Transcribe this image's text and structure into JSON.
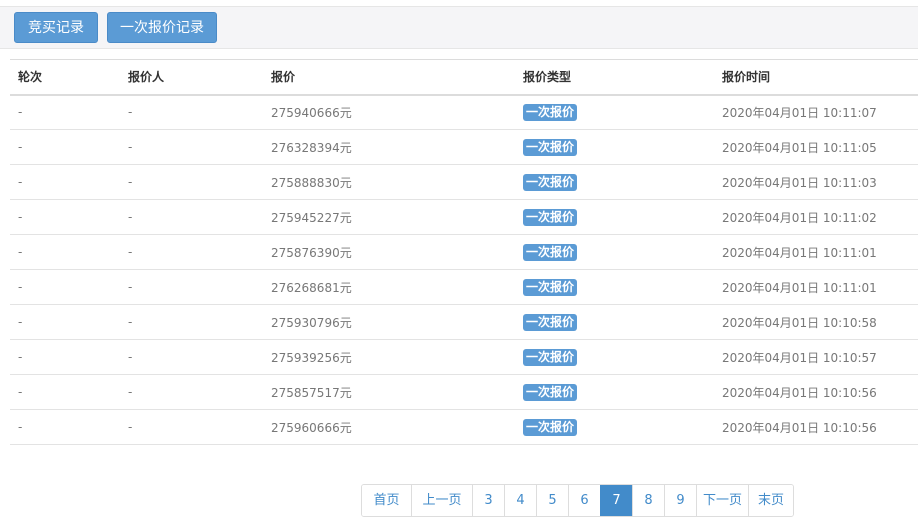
{
  "tabs": {
    "bid_records": "竞买记录",
    "one_time_quote_records": "一次报价记录"
  },
  "table": {
    "headers": {
      "round": "轮次",
      "bidder": "报价人",
      "price": "报价",
      "type": "报价类型",
      "time": "报价时间"
    },
    "rows": [
      {
        "round": "-",
        "bidder": "-",
        "price": "275940666元",
        "type": "一次报价",
        "time": "2020年04月01日 10:11:07"
      },
      {
        "round": "-",
        "bidder": "-",
        "price": "276328394元",
        "type": "一次报价",
        "time": "2020年04月01日 10:11:05"
      },
      {
        "round": "-",
        "bidder": "-",
        "price": "275888830元",
        "type": "一次报价",
        "time": "2020年04月01日 10:11:03"
      },
      {
        "round": "-",
        "bidder": "-",
        "price": "275945227元",
        "type": "一次报价",
        "time": "2020年04月01日 10:11:02"
      },
      {
        "round": "-",
        "bidder": "-",
        "price": "275876390元",
        "type": "一次报价",
        "time": "2020年04月01日 10:11:01"
      },
      {
        "round": "-",
        "bidder": "-",
        "price": "276268681元",
        "type": "一次报价",
        "time": "2020年04月01日 10:11:01"
      },
      {
        "round": "-",
        "bidder": "-",
        "price": "275930796元",
        "type": "一次报价",
        "time": "2020年04月01日 10:10:58"
      },
      {
        "round": "-",
        "bidder": "-",
        "price": "275939256元",
        "type": "一次报价",
        "time": "2020年04月01日 10:10:57"
      },
      {
        "round": "-",
        "bidder": "-",
        "price": "275857517元",
        "type": "一次报价",
        "time": "2020年04月01日 10:10:56"
      },
      {
        "round": "-",
        "bidder": "-",
        "price": "275960666元",
        "type": "一次报价",
        "time": "2020年04月01日 10:10:56"
      }
    ]
  },
  "pagination": {
    "items": [
      {
        "label": "首页",
        "active": false
      },
      {
        "label": "上一页",
        "active": false
      },
      {
        "label": "3",
        "active": false
      },
      {
        "label": "4",
        "active": false
      },
      {
        "label": "5",
        "active": false
      },
      {
        "label": "6",
        "active": false
      },
      {
        "label": "7",
        "active": true
      },
      {
        "label": "8",
        "active": false
      },
      {
        "label": "9",
        "active": false
      },
      {
        "label": "下一页",
        "active": false
      },
      {
        "label": "末页",
        "active": false
      }
    ]
  },
  "colors": {
    "button_blue": "#5b9bd5",
    "pagination_active": "#428bca"
  }
}
